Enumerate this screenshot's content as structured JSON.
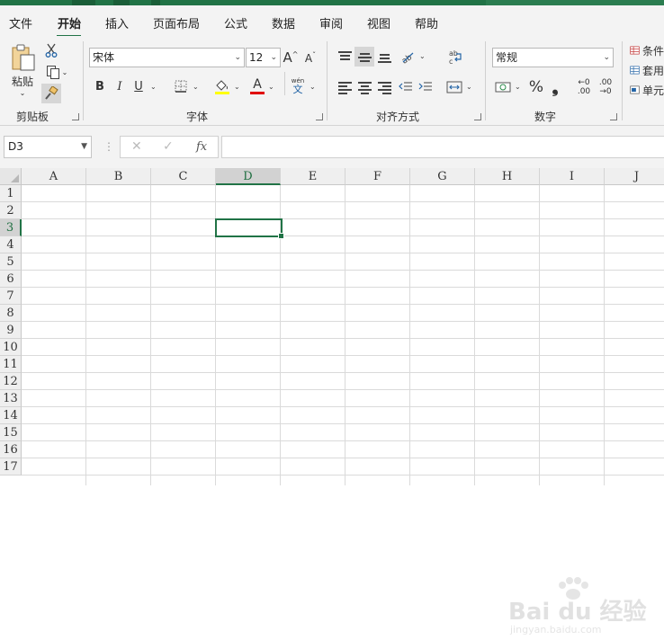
{
  "menu": {
    "tabs": [
      {
        "label": "文件"
      },
      {
        "label": "开始",
        "active": true
      },
      {
        "label": "插入"
      },
      {
        "label": "页面布局"
      },
      {
        "label": "公式"
      },
      {
        "label": "数据"
      },
      {
        "label": "审阅"
      },
      {
        "label": "视图"
      },
      {
        "label": "帮助"
      }
    ]
  },
  "ribbon": {
    "clipboard": {
      "label": "剪贴板",
      "paste_label": "粘贴"
    },
    "font": {
      "label": "字体",
      "font_name": "宋体",
      "font_size": "12",
      "phonetic_top": "wén",
      "phonetic_bottom": "文",
      "bold": "B",
      "italic": "I",
      "underline": "U",
      "font_color": "#e00000",
      "highlight_color": "#ffff00"
    },
    "alignment": {
      "label": "对齐方式"
    },
    "number": {
      "label": "数字",
      "format": "常规",
      "percent": "%",
      "comma": "❟",
      "inc_top": "←0",
      "inc_bottom": ".00",
      "dec_top": ".00",
      "dec_bottom": "→0"
    },
    "styles": {
      "items": [
        "条件",
        "套用",
        "单元"
      ]
    }
  },
  "formula_bar": {
    "name_box": "D3",
    "cancel": "✕",
    "enter": "✓",
    "fx": "fx",
    "value": ""
  },
  "sheet": {
    "columns": [
      "A",
      "B",
      "C",
      "D",
      "E",
      "F",
      "G",
      "H",
      "I",
      "J"
    ],
    "rows": [
      "1",
      "2",
      "3",
      "4",
      "5",
      "6",
      "7",
      "8",
      "9",
      "10",
      "11",
      "12",
      "13",
      "14",
      "15",
      "16",
      "17"
    ],
    "selected_col": "D",
    "selected_row": "3"
  },
  "watermark": {
    "brand": "Bai du 经验",
    "url": "jingyan.baidu.com"
  },
  "colors": {
    "accent": "#217346"
  }
}
